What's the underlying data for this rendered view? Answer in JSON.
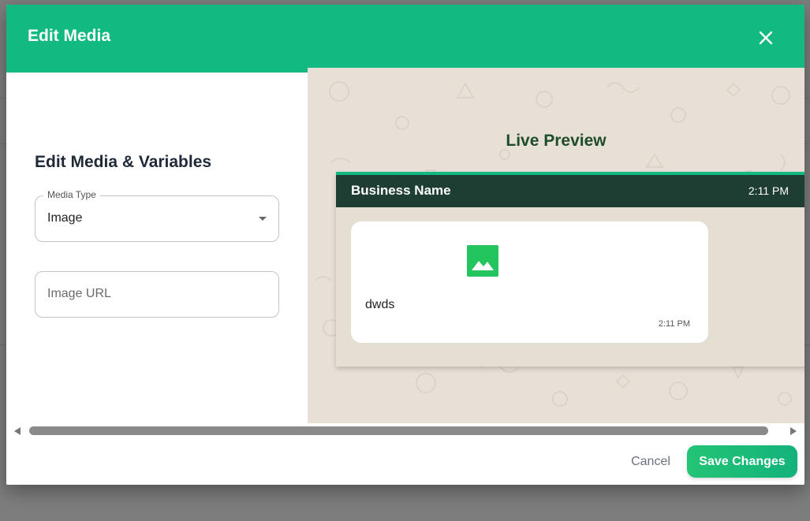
{
  "modal": {
    "title": "Edit Media",
    "close_icon": "close-icon"
  },
  "left_panel": {
    "heading": "Edit Media & Variables",
    "media_type": {
      "label": "Media Type",
      "value": "Image"
    },
    "image_url": {
      "placeholder": "Image URL",
      "value": ""
    }
  },
  "preview": {
    "title": "Live Preview",
    "chat": {
      "business_name": "Business Name",
      "header_time": "2:11 PM",
      "media_icon": "image-icon",
      "message_text": "dwds",
      "message_time": "2:11 PM"
    }
  },
  "footer": {
    "cancel_label": "Cancel",
    "save_label": "Save Changes"
  },
  "colors": {
    "brand_green": "#12b981",
    "chat_header": "#1e3d33",
    "preview_bg": "#e7e0d7",
    "preview_title": "#1f4d2b",
    "media_icon_green": "#22c55e"
  }
}
